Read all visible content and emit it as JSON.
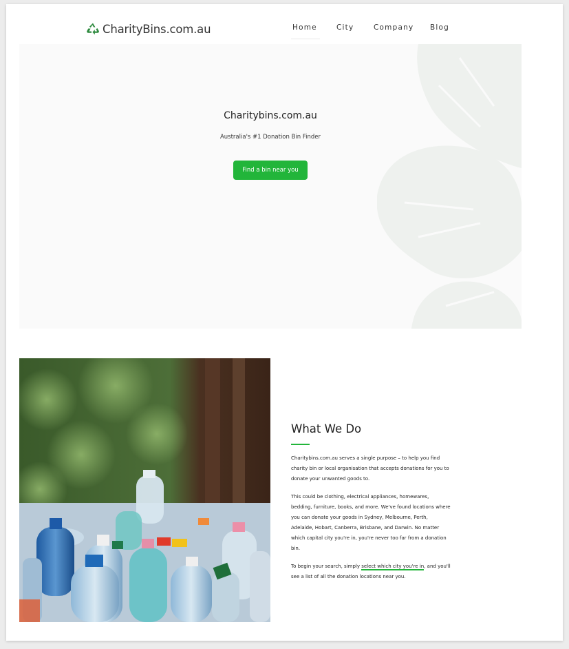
{
  "brand": {
    "name": "CharityBins.com.au",
    "icon": "recycle-icon",
    "accent": "#22b53a"
  },
  "nav": {
    "items": [
      "Home",
      "City",
      "Company",
      "Blog"
    ],
    "active": "Home"
  },
  "hero": {
    "title": "Charitybins.com.au",
    "subtitle": "Australia's #1 Donation Bin Finder",
    "button": "Find a bin near you"
  },
  "what_we_do": {
    "title": "What We Do",
    "p1": "Charitybins.com.au serves a single purpose – to help you find charity bin or local organisation that accepts donations for you to donate your unwanted goods to.",
    "p2": "This could be clothing, electrical appliances, homewares, bedding, furniture, books, and more. We've found locations where you can donate your goods in Sydney, Melbourne, Perth, Adelaide, Hobart, Canberra, Brisbane, and Darwin. No matter which capital city you're in, you're never too far from a donation bin.",
    "p3_before": "To begin your search, simply ",
    "p3_link": "select which city you're in",
    "p3_after": ", and you'll see a list of all the donation locations near you."
  }
}
